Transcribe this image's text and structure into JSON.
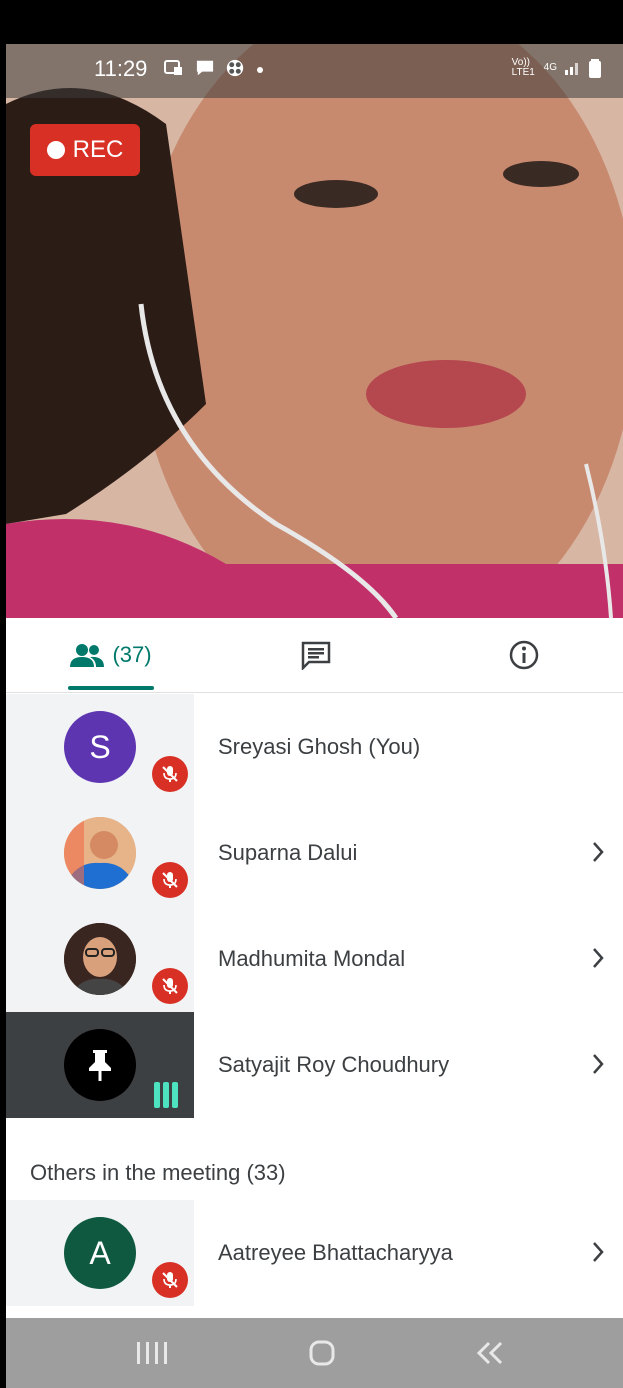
{
  "status_bar": {
    "time": "11:29",
    "network_label": "Vo)) LTE1",
    "network_type": "4G"
  },
  "recording": {
    "label": "REC"
  },
  "tabs": {
    "people_count": "(37)",
    "accent": "#00796b"
  },
  "participants": [
    {
      "name": "Sreyasi Ghosh (You)",
      "initial": "S",
      "avatar_color": "#5e35b1",
      "muted": true
    },
    {
      "name": "Suparna Dalui",
      "initial": "",
      "avatar_color": "#e89a6a",
      "muted": true
    },
    {
      "name": "Madhumita Mondal",
      "initial": "",
      "avatar_color": "#6d4c41",
      "muted": true
    },
    {
      "name": "Satyajit Roy Choudhury",
      "initial": "",
      "avatar_color": "#000000",
      "muted": false,
      "speaking": true
    }
  ],
  "others": {
    "header": "Others in the meeting (33)",
    "items": [
      {
        "name": "Aatreyee Bhattacharyya",
        "initial": "A",
        "avatar_color": "#0f5940",
        "muted": true
      }
    ]
  },
  "colors": {
    "mute_red": "#d93025",
    "speaking_green": "#4de3c0"
  }
}
